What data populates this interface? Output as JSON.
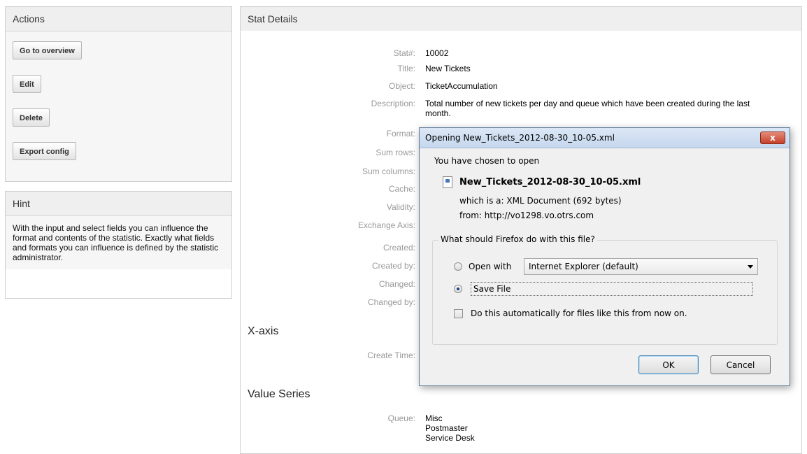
{
  "actions": {
    "title": "Actions",
    "buttons": [
      "Go to overview",
      "Edit",
      "Delete",
      "Export config"
    ]
  },
  "hint": {
    "title": "Hint",
    "text": "With the input and select fields you can influence the format and contents of the statistic. Exactly what fields and formats you can influence is defined by the statistic administrator."
  },
  "stat_details": {
    "title": "Stat Details",
    "fields": [
      {
        "label": "Stat#:",
        "value": "10002"
      },
      {
        "label": "Title:",
        "value": "New Tickets"
      },
      {
        "label": "Object:",
        "value": "TicketAccumulation"
      },
      {
        "label": "Description:",
        "value": "Total number of new tickets per day and queue which have been created during the last month."
      },
      {
        "label": "Format:",
        "value": ""
      },
      {
        "label": "Sum rows:",
        "value": ""
      },
      {
        "label": "Sum columns:",
        "value": ""
      },
      {
        "label": "Cache:",
        "value": ""
      },
      {
        "label": "Validity:",
        "value": ""
      },
      {
        "label": "Exchange Axis:",
        "value": ""
      },
      {
        "label": "Created:",
        "value": ""
      },
      {
        "label": "Created by:",
        "value": ""
      },
      {
        "label": "Changed:",
        "value": ""
      },
      {
        "label": "Changed by:",
        "value": ""
      }
    ],
    "x_axis": {
      "title": "X-axis",
      "fields": [
        {
          "label": "Create Time:",
          "value": ""
        }
      ]
    },
    "value_series": {
      "title": "Value Series",
      "queue_label": "Queue:",
      "queues": [
        "Misc",
        "Postmaster",
        "Service Desk"
      ]
    }
  },
  "dialog": {
    "title": "Opening New_Tickets_2012-08-30_10-05.xml",
    "close_label": "x",
    "intro": "You have chosen to open",
    "filename": "New_Tickets_2012-08-30_10-05.xml",
    "which_is_label": "which is a:",
    "which_is_value": "XML Document (692 bytes)",
    "from_label": "from:",
    "from_value": "http://vo1298.vo.otrs.com",
    "question": "What should Firefox do with this file?",
    "open_with_label": "Open with",
    "open_with_selected": "Internet Explorer (default)",
    "save_file_label": "Save File",
    "save_file_selected": true,
    "auto_label": "Do this automatically for files like this from now on.",
    "auto_checked": false,
    "ok_label": "OK",
    "cancel_label": "Cancel"
  }
}
